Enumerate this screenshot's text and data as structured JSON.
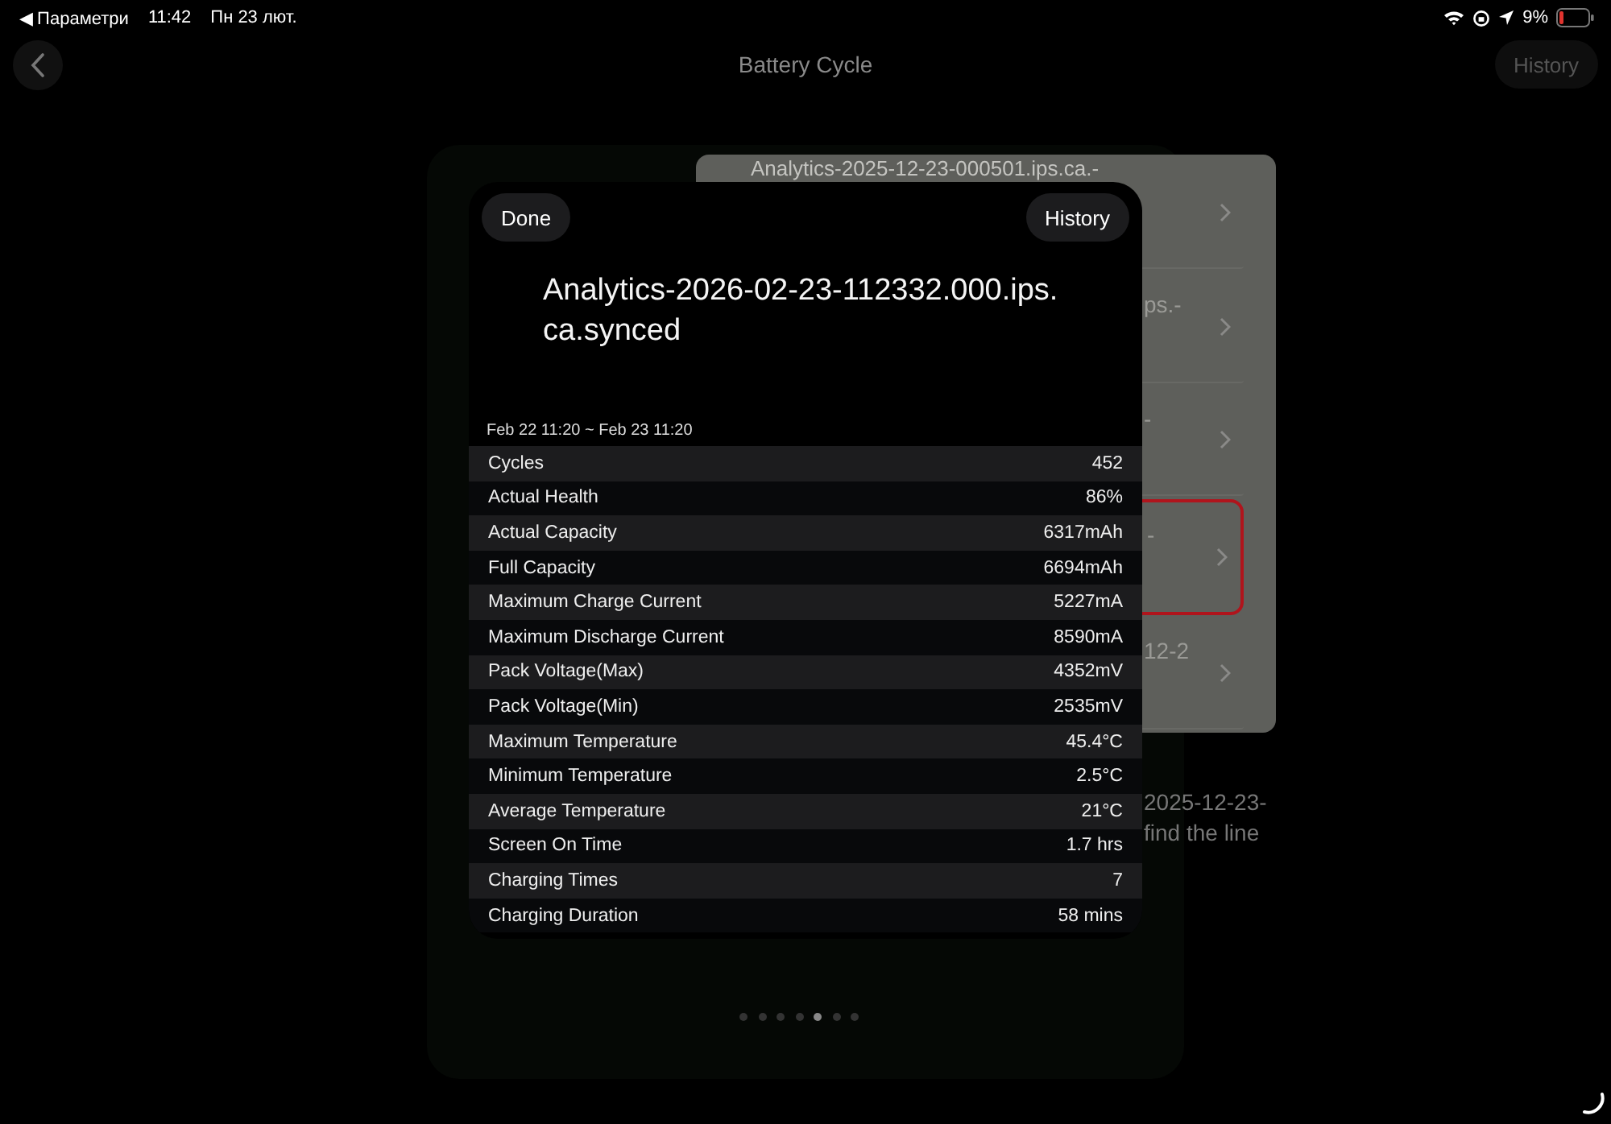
{
  "status_bar": {
    "back_label": "◀ Параметри",
    "time": "11:42",
    "date": "Пн 23 лют.",
    "battery": "9%"
  },
  "nav": {
    "title": "Battery Cycle",
    "history": "History"
  },
  "background_list": {
    "items": [
      {
        "text": "Analytics-2025-12-23-000501.ips.ca.-",
        "selected": false
      },
      {
        "text": "ps.-",
        "selected": false
      },
      {
        "text": "-",
        "selected": false
      },
      {
        "text": "-",
        "selected": true
      },
      {
        "text": "12-2",
        "selected": false
      }
    ],
    "note_lines": [
      "2025-12-23-",
      "find the line"
    ]
  },
  "modal": {
    "done": "Done",
    "history": "History",
    "title_lines": [
      "Analytics-2026-02-23-112332.000.ips.",
      "ca.synced"
    ],
    "range": "Feb 22 11:20 ~ Feb 23 11:20",
    "rows": [
      {
        "label": "Cycles",
        "value": "452"
      },
      {
        "label": "Actual Health",
        "value": "86%"
      },
      {
        "label": "Actual Capacity",
        "value": "6317mAh"
      },
      {
        "label": "Full Capacity",
        "value": "6694mAh"
      },
      {
        "label": "Maximum Charge Current",
        "value": "5227mA"
      },
      {
        "label": "Maximum Discharge Current",
        "value": "8590mA"
      },
      {
        "label": "Pack Voltage(Max)",
        "value": "4352mV"
      },
      {
        "label": "Pack Voltage(Min)",
        "value": "2535mV"
      },
      {
        "label": "Maximum Temperature",
        "value": "45.4°C"
      },
      {
        "label": "Minimum Temperature",
        "value": "2.5°C"
      },
      {
        "label": "Average Temperature",
        "value": "21°C"
      },
      {
        "label": "Screen On Time",
        "value": "1.7 hrs"
      },
      {
        "label": "Charging Times",
        "value": "7"
      },
      {
        "label": "Charging Duration",
        "value": "58 mins"
      }
    ]
  },
  "page_dots": [
    {
      "selected": false
    },
    {
      "selected": false
    },
    {
      "selected": false
    },
    {
      "selected": false
    },
    {
      "selected": true
    },
    {
      "selected": false
    },
    {
      "selected": false
    }
  ]
}
